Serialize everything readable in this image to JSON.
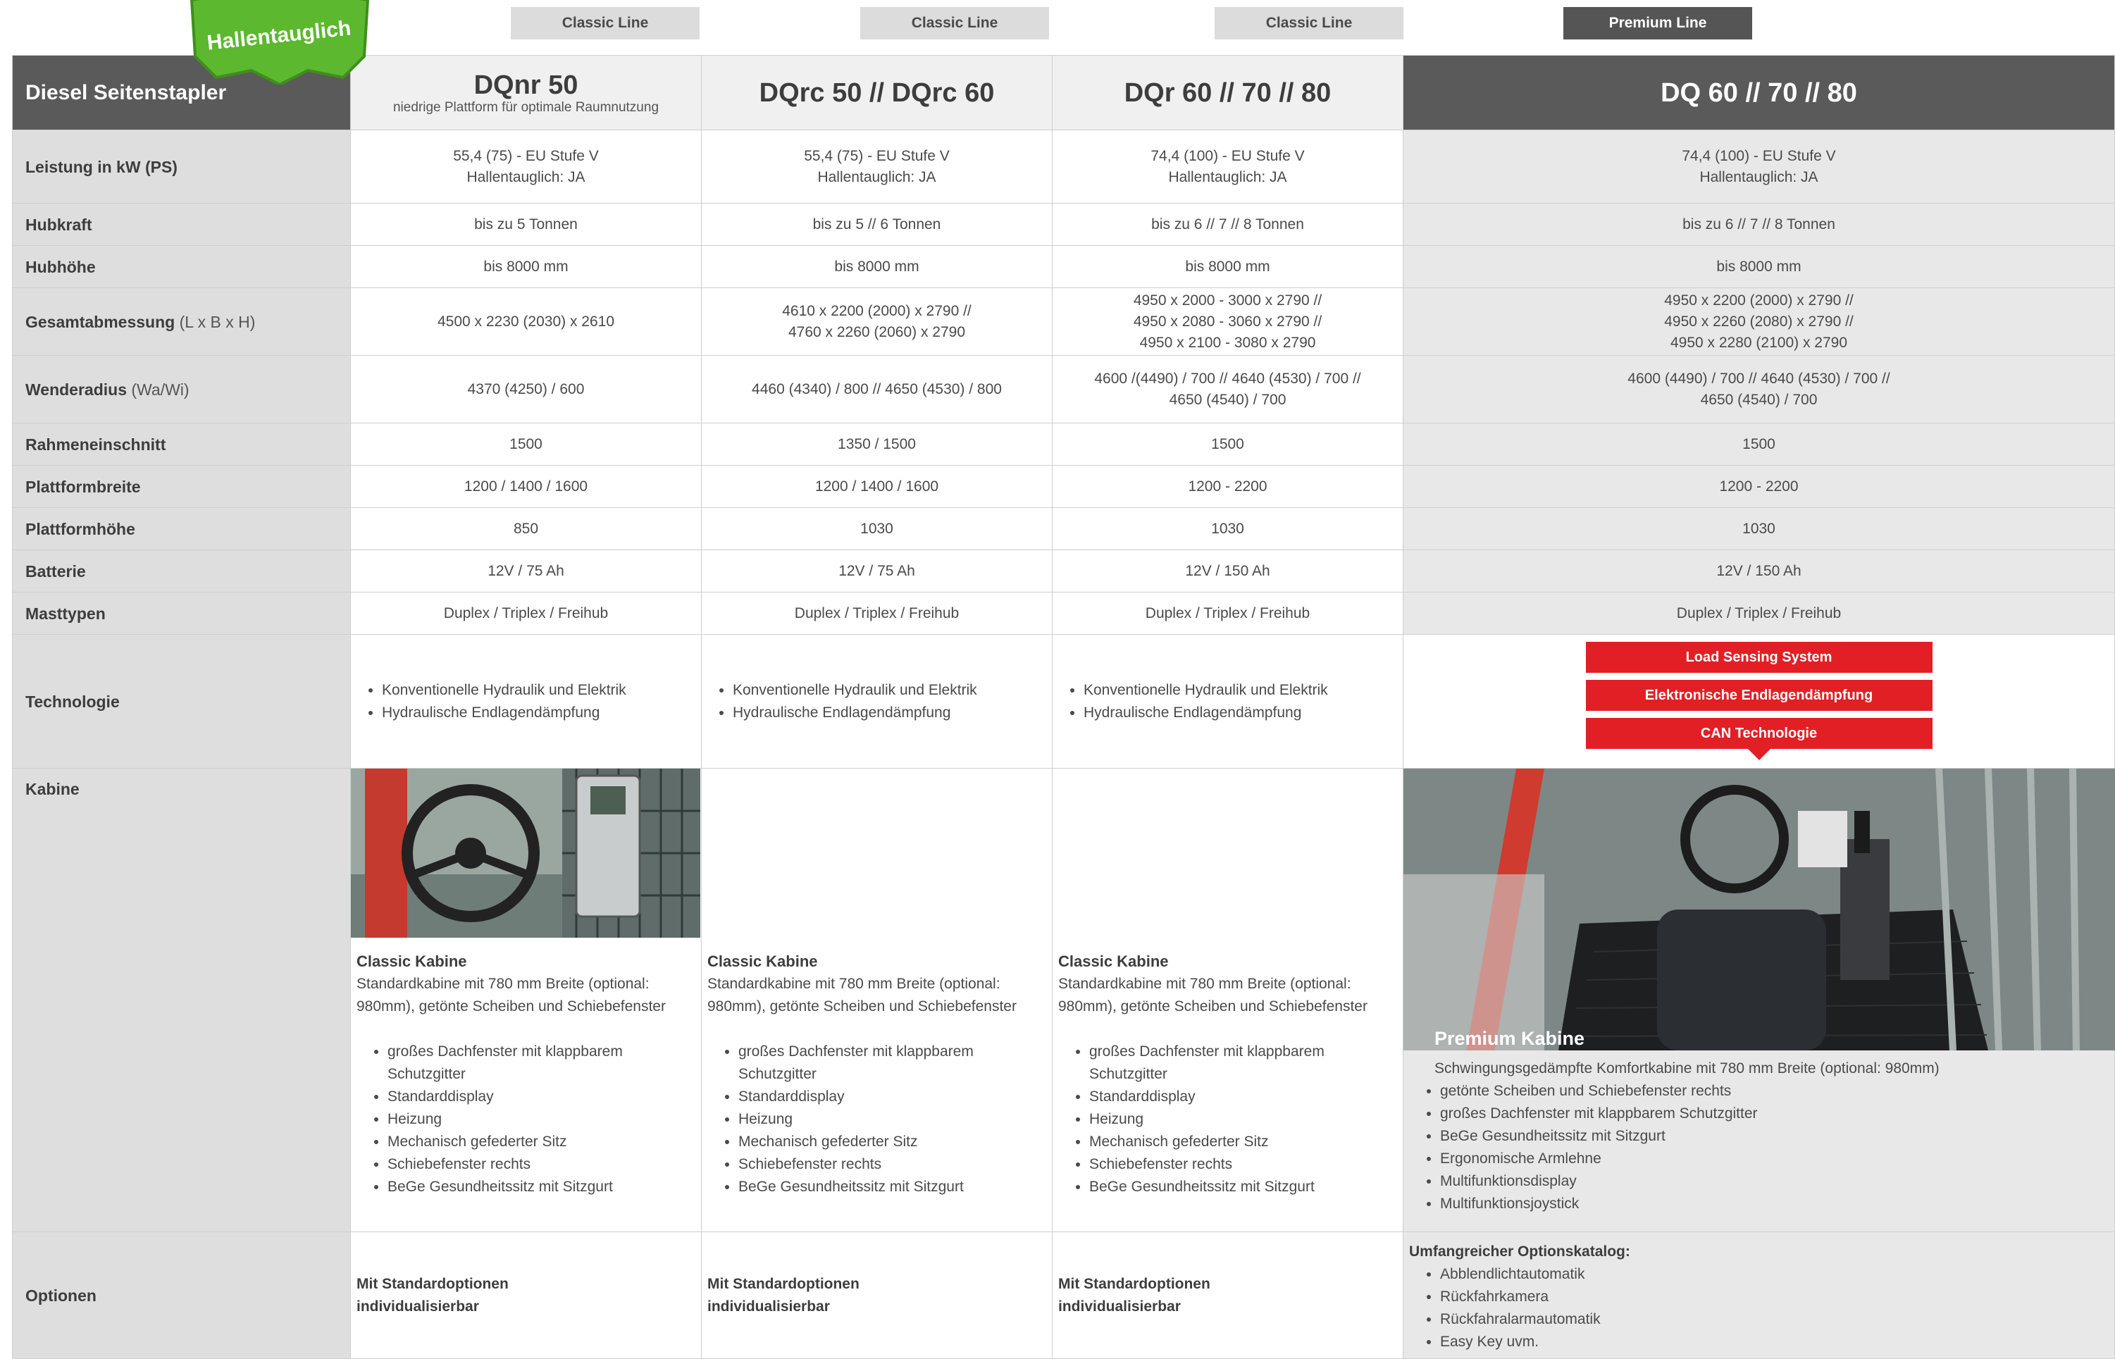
{
  "badge": {
    "text": "Hallentauglich"
  },
  "lines": [
    "Classic Line",
    "Classic Line",
    "Classic Line",
    "Premium Line"
  ],
  "header": {
    "title": "Diesel Seitenstapler",
    "models": [
      {
        "name": "DQnr 50",
        "sub": "niedrige Plattform für optimale Raumnutzung"
      },
      {
        "name": "DQrc 50 // DQrc 60",
        "sub": ""
      },
      {
        "name": "DQr 60 // 70 // 80",
        "sub": ""
      },
      {
        "name": "DQ 60 // 70 // 80",
        "sub": ""
      }
    ]
  },
  "rows": [
    {
      "label": "Leistung in kW (PS)",
      "unit": "",
      "values": [
        [
          "55,4 (75) - EU Stufe V",
          "Hallentauglich: JA"
        ],
        [
          "55,4 (75) - EU Stufe V",
          "Hallentauglich: JA"
        ],
        [
          "74,4 (100) - EU Stufe V",
          "Hallentauglich: JA"
        ],
        [
          "74,4 (100) - EU Stufe V",
          "Hallentauglich: JA"
        ]
      ]
    },
    {
      "label": "Hubkraft",
      "unit": "",
      "values": [
        [
          "bis zu 5 Tonnen"
        ],
        [
          "bis zu 5 // 6 Tonnen"
        ],
        [
          "bis zu 6 // 7 // 8 Tonnen"
        ],
        [
          "bis zu 6 // 7 // 8 Tonnen"
        ]
      ]
    },
    {
      "label": "Hubhöhe",
      "unit": "",
      "values": [
        [
          "bis 8000 mm"
        ],
        [
          "bis 8000 mm"
        ],
        [
          "bis 8000 mm"
        ],
        [
          "bis 8000 mm"
        ]
      ]
    },
    {
      "label": "Gesamtabmessung",
      "unit": "(L x B x H)",
      "values": [
        [
          "4500 x 2230 (2030) x 2610"
        ],
        [
          "4610 x 2200 (2000) x 2790  //",
          "4760 x 2260 (2060) x 2790"
        ],
        [
          "4950 x 2000 - 3000 x 2790 //",
          "4950 x 2080 - 3060 x 2790 //",
          "4950 x 2100 - 3080 x 2790"
        ],
        [
          "4950 x 2200 (2000)  x 2790 //",
          "4950 x 2260 (2080)  x 2790 //",
          "4950 x 2280 (2100)  x 2790"
        ]
      ]
    },
    {
      "label": "Wenderadius",
      "unit": "(Wa/Wi)",
      "values": [
        [
          "4370 (4250) / 600"
        ],
        [
          "4460 (4340) / 800 // 4650 (4530) / 800"
        ],
        [
          "4600 /(4490) / 700 // 4640 (4530) / 700 //",
          "4650 (4540) / 700"
        ],
        [
          "4600 (4490) / 700 // 4640 (4530) / 700 //",
          "4650 (4540) / 700"
        ]
      ]
    },
    {
      "label": "Rahmeneinschnitt",
      "unit": "",
      "values": [
        [
          "1500"
        ],
        [
          "1350 / 1500"
        ],
        [
          "1500"
        ],
        [
          "1500"
        ]
      ]
    },
    {
      "label": "Plattformbreite",
      "unit": "",
      "values": [
        [
          "1200 / 1400 / 1600"
        ],
        [
          "1200 / 1400 / 1600"
        ],
        [
          "1200 - 2200"
        ],
        [
          "1200 - 2200"
        ]
      ]
    },
    {
      "label": "Plattformhöhe",
      "unit": "",
      "values": [
        [
          "850"
        ],
        [
          "1030"
        ],
        [
          "1030"
        ],
        [
          "1030"
        ]
      ]
    },
    {
      "label": "Batterie",
      "unit": "",
      "values": [
        [
          "12V / 75 Ah"
        ],
        [
          "12V / 75 Ah"
        ],
        [
          "12V / 150 Ah"
        ],
        [
          "12V / 150 Ah"
        ]
      ]
    },
    {
      "label": "Masttypen",
      "unit": "",
      "values": [
        [
          "Duplex / Triplex / Freihub"
        ],
        [
          "Duplex / Triplex / Freihub"
        ],
        [
          "Duplex / Triplex / Freihub"
        ],
        [
          "Duplex / Triplex / Freihub"
        ]
      ]
    }
  ],
  "technologie": {
    "label": "Technologie",
    "classic": [
      "Konventionelle Hydraulik und Elektrik",
      "Hydraulische Endlagendämpfung"
    ],
    "premium": [
      "Load Sensing System",
      "Elektronische Endlagendämpfung",
      "CAN Technologie"
    ]
  },
  "kabine": {
    "label": "Kabine",
    "classic_title": "Classic Kabine",
    "classic_desc": "Standardkabine mit 780 mm Breite (optional: 980mm), getönte Scheiben und Schiebefenster",
    "classic_items": [
      "großes Dachfenster mit klappbarem Schutzgitter",
      "Standarddisplay",
      "Heizung",
      "Mechanisch gefederter Sitz",
      "Schiebefenster rechts",
      "BeGe Gesundheitssitz mit Sitzgurt"
    ],
    "premium_title": "Premium Kabine",
    "premium_desc": "Schwingungsgedämpfte Komfortkabine mit 780 mm Breite (optional: 980mm)",
    "premium_items": [
      "getönte Scheiben und Schiebefenster rechts",
      "großes Dachfenster mit klappbarem Schutzgitter",
      "BeGe Gesundheitssitz mit Sitzgurt",
      "Ergonomische Armlehne",
      "Multifunktionsdisplay",
      "Multifunktionsjoystick"
    ]
  },
  "optionen": {
    "label": "Optionen",
    "classic_text": [
      "Mit Standardoptionen",
      "individualisierbar"
    ],
    "premium_title": "Umfangreicher Optionskatalog:",
    "premium_items": [
      "Abblendlichtautomatik",
      "Rückfahrkamera",
      "Rückfahralarmautomatik",
      "Easy Key uvm."
    ]
  },
  "colors": {
    "accent_red": "#e31f26",
    "badge_green": "#5cb82e",
    "header_dark": "#5a5a5a",
    "label_gray": "#dedede"
  }
}
